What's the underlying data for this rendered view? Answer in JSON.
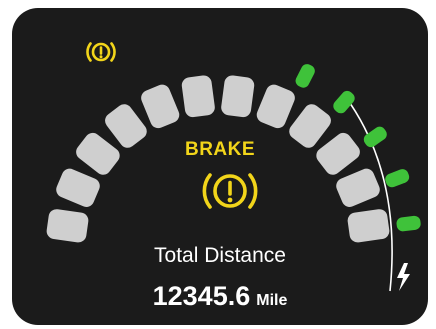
{
  "warning_indicator": {
    "icon": "parking-brake-warning-icon",
    "color": "#f2d51a",
    "active": true
  },
  "brake_warning": {
    "label": "BRAKE",
    "icon": "brake-warning-icon",
    "color": "#f2d51a"
  },
  "speed_gauge": {
    "total_segments": 12,
    "segment_color": "#cfcfcf"
  },
  "charge_gauge": {
    "total_segments": 5,
    "filled_segments": 5,
    "fill_fraction": 1.0,
    "fill_color": "#3fc23a",
    "icon": "charging-bolt-icon"
  },
  "odometer": {
    "title": "Total Distance",
    "value": "12345.6",
    "unit": "Mile"
  }
}
